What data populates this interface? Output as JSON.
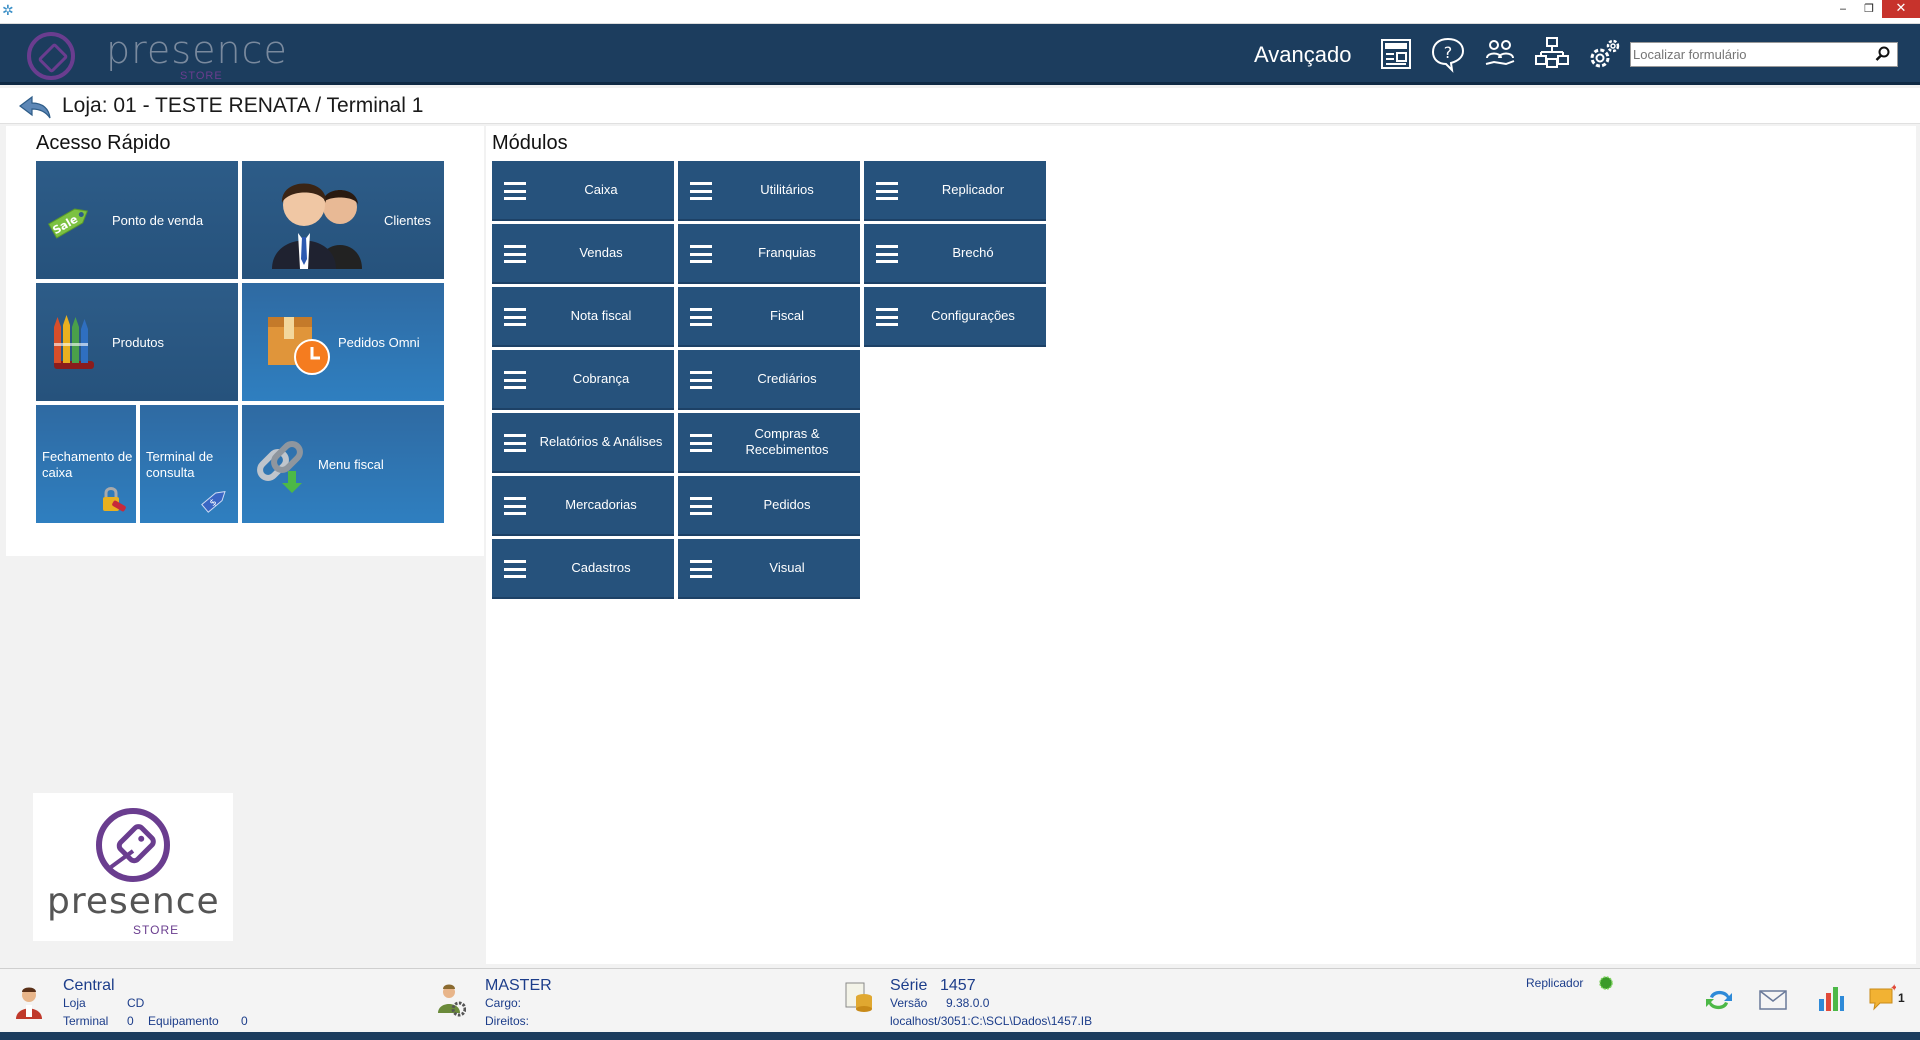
{
  "window": {
    "minimize": "‒",
    "restore": "❐",
    "close": "✕"
  },
  "header": {
    "logo_text": "presence",
    "logo_sub": "STORE",
    "advanced_label": "Avançado",
    "search_placeholder": "Localizar formulário",
    "icons": [
      "news-icon",
      "help-icon",
      "users-icon",
      "network-icon",
      "settings-icon"
    ]
  },
  "breadcrumb": {
    "title": "Loja: 01 - TESTE RENATA / Terminal 1"
  },
  "quick_access": {
    "title": "Acesso Rápido",
    "tiles": {
      "pdv": "Ponto de venda",
      "clientes": "Clientes",
      "produtos": "Produtos",
      "pedidos_omni": "Pedidos Omni",
      "fechamento": "Fechamento de caixa",
      "terminal": "Terminal de consulta",
      "menu_fiscal": "Menu fiscal"
    },
    "sale_badge": "Sale"
  },
  "modules": {
    "title": "Módulos",
    "col1": [
      "Caixa",
      "Vendas",
      "Nota fiscal",
      "Cobrança",
      "Relatórios & Análises",
      "Mercadorias",
      "Cadastros"
    ],
    "col2": [
      "Utilitários",
      "Franquias",
      "Fiscal",
      "Crediários",
      "Compras & Recebimentos",
      "Pedidos",
      "Visual"
    ],
    "col3": [
      "Replicador",
      "Brechó",
      "Configurações"
    ]
  },
  "big_logo": {
    "text": "presence",
    "sub": "STORE"
  },
  "status": {
    "central": "Central",
    "loja_label": "Loja",
    "loja_value": "CD",
    "terminal_label": "Terminal",
    "terminal_value": "0",
    "equip_label": "Equipamento",
    "equip_value": "0",
    "user": "MASTER",
    "cargo_label": "Cargo:",
    "direitos_label": "Direitos:",
    "serie_label": "Série",
    "serie_value": "1457",
    "versao_label": "Versão",
    "versao_value": "9.38.0.0",
    "db_path": "localhost/3051:C:\\SCL\\Dados\\1457.IB",
    "replicador_label": "Replicador",
    "replicador_status_color": "#3a9a2a",
    "messages_count": "1"
  },
  "colors": {
    "header": "#1c3d5e",
    "tile": "#26527c",
    "accent_purple": "#6a3d8f"
  }
}
